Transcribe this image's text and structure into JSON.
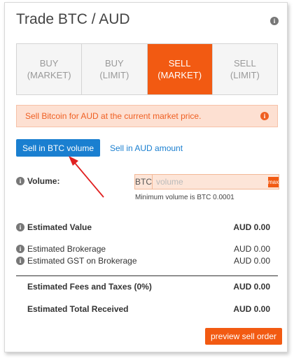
{
  "header": {
    "title": "Trade BTC / AUD",
    "info_icon": "info-icon"
  },
  "tabs": [
    {
      "line1": "BUY",
      "line2": "(MARKET)",
      "active": false
    },
    {
      "line1": "BUY",
      "line2": "(LIMIT)",
      "active": false
    },
    {
      "line1": "SELL",
      "line2": "(MARKET)",
      "active": true
    },
    {
      "line1": "SELL",
      "line2": "(LIMIT)",
      "active": false
    }
  ],
  "alert": {
    "text": "Sell Bitcoin for AUD at the current market price.",
    "icon": "info-icon"
  },
  "mode": {
    "active_label": "Sell in BTC volume",
    "alt_label": "Sell in AUD amount"
  },
  "volume": {
    "label": "Volume:",
    "prefix": "BTC",
    "placeholder": "volume",
    "value": "",
    "max_label": "max",
    "hint": "Minimum volume is BTC 0.0001"
  },
  "estimates": {
    "value_label": "Estimated Value",
    "value": "AUD 0.00",
    "brokerage_label": "Estimated Brokerage",
    "brokerage": "AUD 0.00",
    "gst_label": "Estimated GST on Brokerage",
    "gst": "AUD 0.00",
    "fees_label": "Estimated Fees and Taxes (0%)",
    "fees": "AUD 0.00",
    "total_label": "Estimated Total Received",
    "total": "AUD 0.00"
  },
  "actions": {
    "preview_label": "preview sell order"
  },
  "colors": {
    "accent": "#f25a12",
    "link": "#1a7fd0",
    "alert_bg": "#fde0d2",
    "annotation": "#e02020"
  }
}
